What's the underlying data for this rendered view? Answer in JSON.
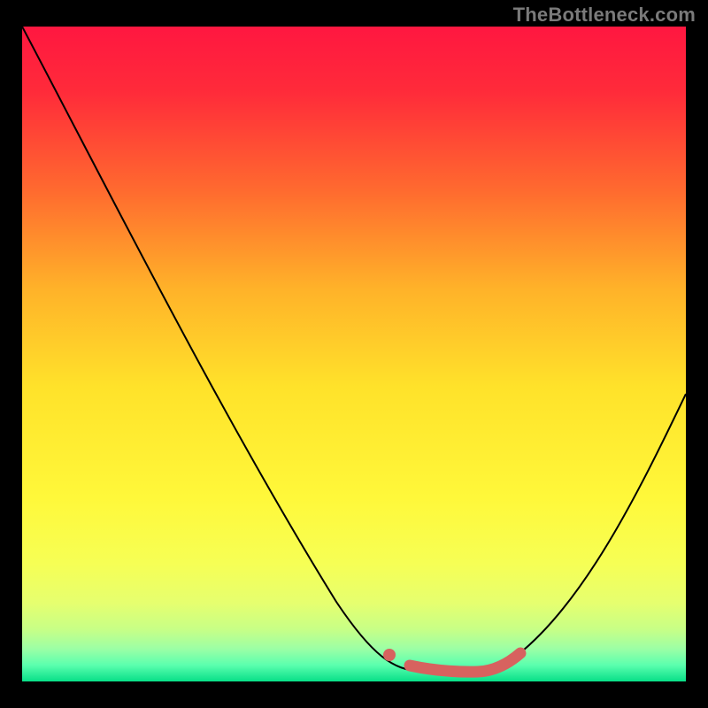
{
  "attribution": "TheBottleneck.com",
  "colors": {
    "frame_bg": "#000000",
    "gradient_top": "#ff173a",
    "gradient_mid_upper": "#ff8a2a",
    "gradient_mid": "#ffe12a",
    "gradient_low1": "#f8ff5a",
    "gradient_low2": "#eaff7a",
    "gradient_low3": "#c8ff8a",
    "gradient_low4": "#9affad",
    "gradient_low5": "#4fffaf",
    "gradient_bottom": "#06e28a",
    "curve": "#000000",
    "overlay": "#d7625f"
  },
  "chart_data": {
    "type": "line",
    "title": "",
    "xlabel": "",
    "ylabel": "",
    "xlim": [
      0,
      100
    ],
    "ylim": [
      0,
      100
    ],
    "series": [
      {
        "name": "bottleneck-curve",
        "x": [
          0,
          10,
          20,
          30,
          40,
          50,
          56,
          62,
          68,
          74,
          80,
          90,
          100
        ],
        "y": [
          100,
          84,
          68,
          52,
          36,
          18,
          6,
          2,
          2,
          2,
          8,
          24,
          44
        ]
      },
      {
        "name": "optimal-range-overlay",
        "x": [
          56,
          60,
          64,
          68,
          72,
          75
        ],
        "y": [
          4.5,
          2.2,
          2.0,
          2.0,
          2.5,
          5.5
        ]
      }
    ],
    "annotations": [
      {
        "name": "overlay-start-dot",
        "x": 55,
        "y": 6
      }
    ]
  }
}
